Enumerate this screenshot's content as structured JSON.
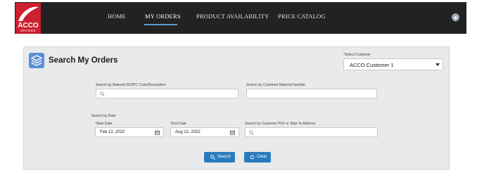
{
  "brand": {
    "logo_line1": "ACCO",
    "logo_line2": "BRANDS"
  },
  "nav": {
    "items": [
      {
        "label": "HOME"
      },
      {
        "label": "MY ORDERS"
      },
      {
        "label": "PRODUCT AVAILABILITY"
      },
      {
        "label": "PRICE CATALOG"
      }
    ],
    "active_item": "MY ORDERS"
  },
  "page": {
    "title": "Search My Orders"
  },
  "customer": {
    "label": "Select Customer",
    "selected": "ACCO Customer 1"
  },
  "fields": {
    "material": {
      "label": "Search by Material ID/UPC Code/Description",
      "value": ""
    },
    "customer_material": {
      "label": "Search by Customer Material Number",
      "value": ""
    },
    "date_section_label": "Search by Date",
    "start_date": {
      "label": "Start Date",
      "value": "Feb 12, 2022"
    },
    "end_date": {
      "label": "End Date",
      "value": "Aug 12, 2022"
    },
    "po_ship": {
      "label": "Search by Customer PO# or Ship-To Address",
      "value": ""
    }
  },
  "buttons": {
    "search": "Search",
    "clear": "Clear"
  },
  "icons": [
    "stack-icon",
    "search-icon",
    "calendar-icon",
    "chevron-down-icon",
    "refresh-icon",
    "user-icon"
  ],
  "colors": {
    "accent": "#2a7bbd",
    "nav_bg": "#222222",
    "brand_red": "#cc1f2f",
    "annotation_arrow": "#d9342b"
  }
}
